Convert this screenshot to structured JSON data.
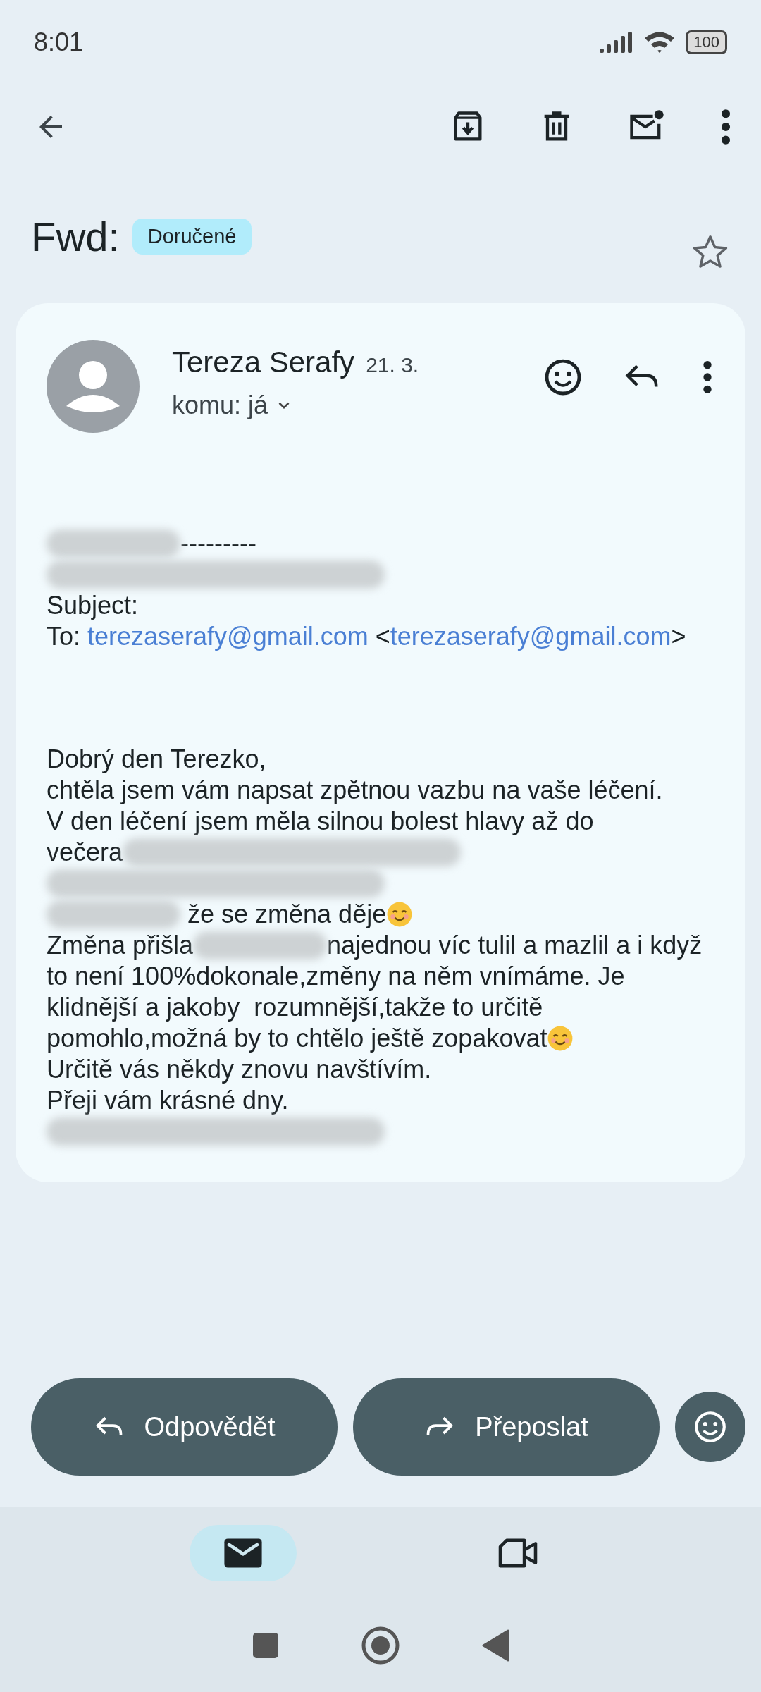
{
  "status_bar": {
    "time": "8:01",
    "battery": "100"
  },
  "subject": {
    "title": "Fwd:",
    "label": "Doručené",
    "starred": false
  },
  "message": {
    "sender": "Tereza Serafy",
    "date": "21. 3.",
    "recipient": "komu: já",
    "header_lines": [
      {
        "parts": [
          {
            "kind": "redacted"
          },
          {
            "kind": "text",
            "text": "---------"
          }
        ]
      },
      {
        "parts": [
          {
            "kind": "redacted"
          }
        ]
      },
      {
        "parts": [
          {
            "kind": "text",
            "text": "Subject:"
          }
        ]
      },
      {
        "parts": [
          {
            "kind": "text",
            "text": "To: "
          },
          {
            "kind": "link",
            "text": "terezaserafy@gmail.com"
          },
          {
            "kind": "text",
            "text": " <"
          },
          {
            "kind": "link",
            "text": "terezaserafy@gmail.com"
          },
          {
            "kind": "text",
            "text": ">"
          }
        ]
      }
    ],
    "body_lines": [
      {
        "parts": [
          {
            "kind": "text",
            "text": "Dobrý den Terezko,"
          }
        ]
      },
      {
        "parts": [
          {
            "kind": "text",
            "text": "chtěla jsem vám napsat zpětnou vazbu na vaše léčení."
          }
        ]
      },
      {
        "parts": [
          {
            "kind": "text",
            "text": "V den léčení jsem měla silnou bolest hlavy až do"
          }
        ]
      },
      {
        "parts": [
          {
            "kind": "text",
            "text": "večera"
          },
          {
            "kind": "redacted"
          }
        ]
      },
      {
        "parts": [
          {
            "kind": "redacted"
          }
        ]
      },
      {
        "parts": [
          {
            "kind": "redacted"
          },
          {
            "kind": "text",
            "text": " že se změna děje"
          },
          {
            "kind": "emoji"
          }
        ]
      },
      {
        "parts": [
          {
            "kind": "text",
            "text": "Změna přišla"
          },
          {
            "kind": "redacted"
          },
          {
            "kind": "text",
            "text": "najednou víc tulil a mazlil a i když"
          }
        ]
      },
      {
        "parts": [
          {
            "kind": "text",
            "text": "to není 100%dokonale,změny na něm vnímáme. Je"
          }
        ]
      },
      {
        "parts": [
          {
            "kind": "text",
            "text": "klidnější a jakoby  rozumnější,takže to určitě"
          }
        ]
      },
      {
        "parts": [
          {
            "kind": "text",
            "text": "pomohlo,možná by to chtělo ještě zopakovat"
          },
          {
            "kind": "emoji"
          }
        ]
      },
      {
        "parts": [
          {
            "kind": "text",
            "text": "Určitě vás někdy znovu navštívím."
          }
        ]
      },
      {
        "parts": [
          {
            "kind": "text",
            "text": "Přeji vám krásné dny."
          }
        ]
      },
      {
        "parts": [
          {
            "kind": "redacted"
          }
        ]
      }
    ]
  },
  "actions": [
    {
      "kind": "reply",
      "label": "Odpovědět"
    },
    {
      "kind": "forward",
      "label": "Přeposlat"
    },
    {
      "kind": "emoji"
    }
  ],
  "bottom_nav": [
    {
      "kind": "mail",
      "selected": true
    },
    {
      "kind": "video",
      "selected": false
    }
  ]
}
